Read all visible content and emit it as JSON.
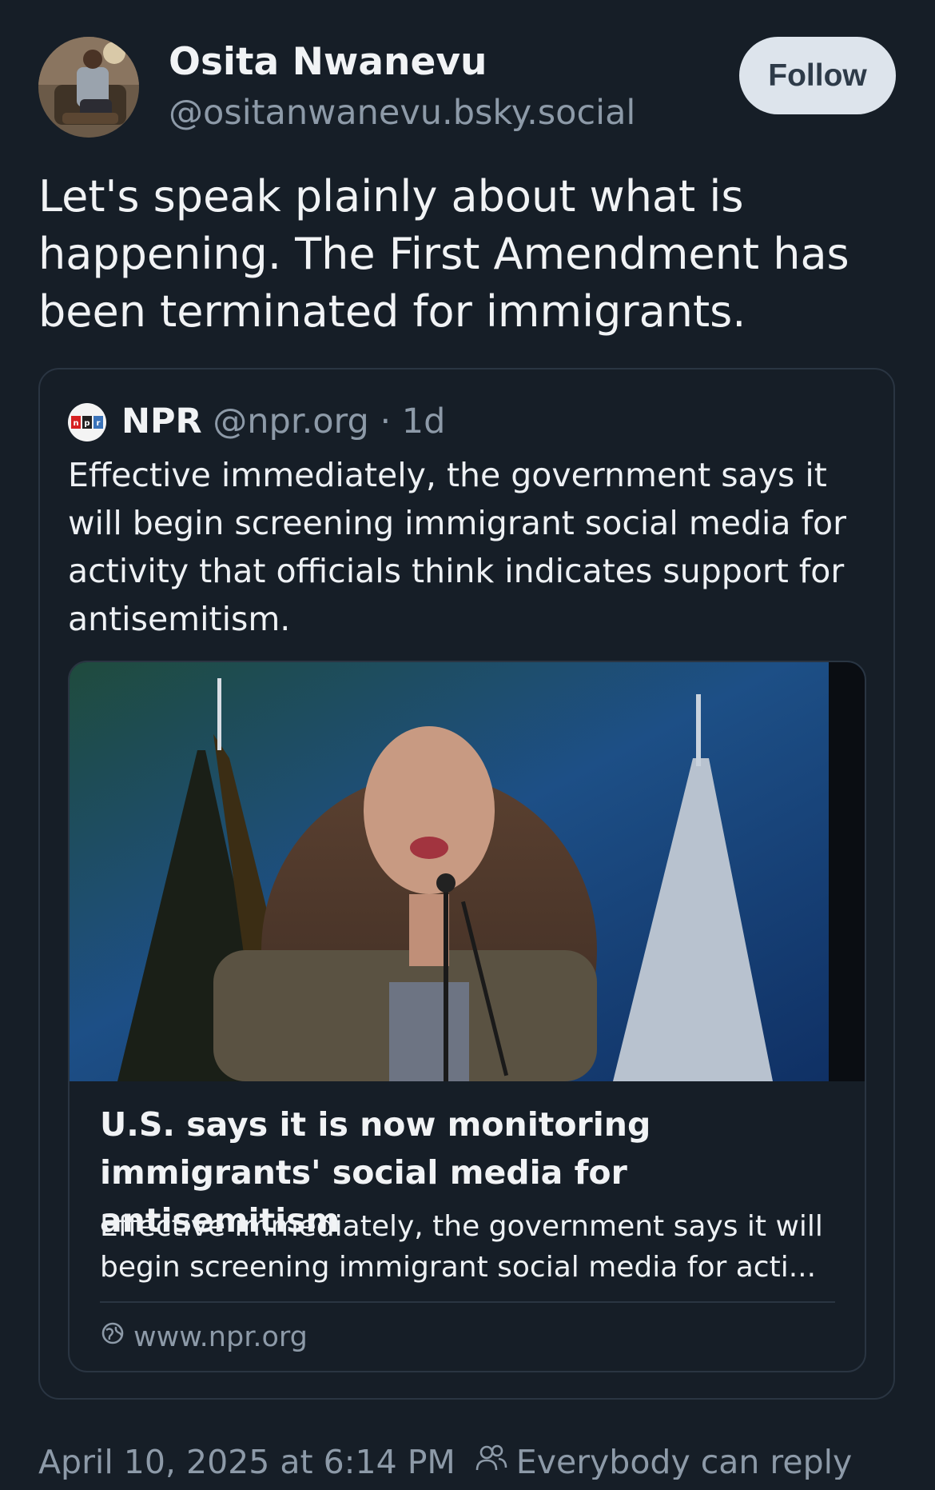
{
  "post": {
    "author_name": "Osita Nwanevu",
    "author_handle": "@ositanwanevu.bsky.social",
    "follow_label": "Follow",
    "text": "Let's speak plainly about what is happening. The First Amendment has been terminated for immigrants.",
    "timestamp": "April 10, 2025 at 6:14 PM",
    "reply_setting": "Everybody can reply"
  },
  "quote": {
    "name": "NPR",
    "handle": "@npr.org",
    "separator": " · ",
    "age": "1d",
    "logo_text": "npr",
    "text": "Effective immediately, the government says it will begin screening immigrant social media for activity that officials think indicates support for antisemitism."
  },
  "link_card": {
    "title": "U.S. says it is now monitoring immigrants' social media for antisemitism",
    "description": "Effective immediately, the government says it will begin screening immigrant social media for acti...",
    "domain": "www.npr.org"
  },
  "icons": {
    "globe": "globe-icon",
    "people": "people-icon"
  },
  "colors": {
    "background": "#161e27",
    "muted_text": "#8d9aa8",
    "follow_bg": "#dde4ec",
    "border": "#2a3542"
  }
}
